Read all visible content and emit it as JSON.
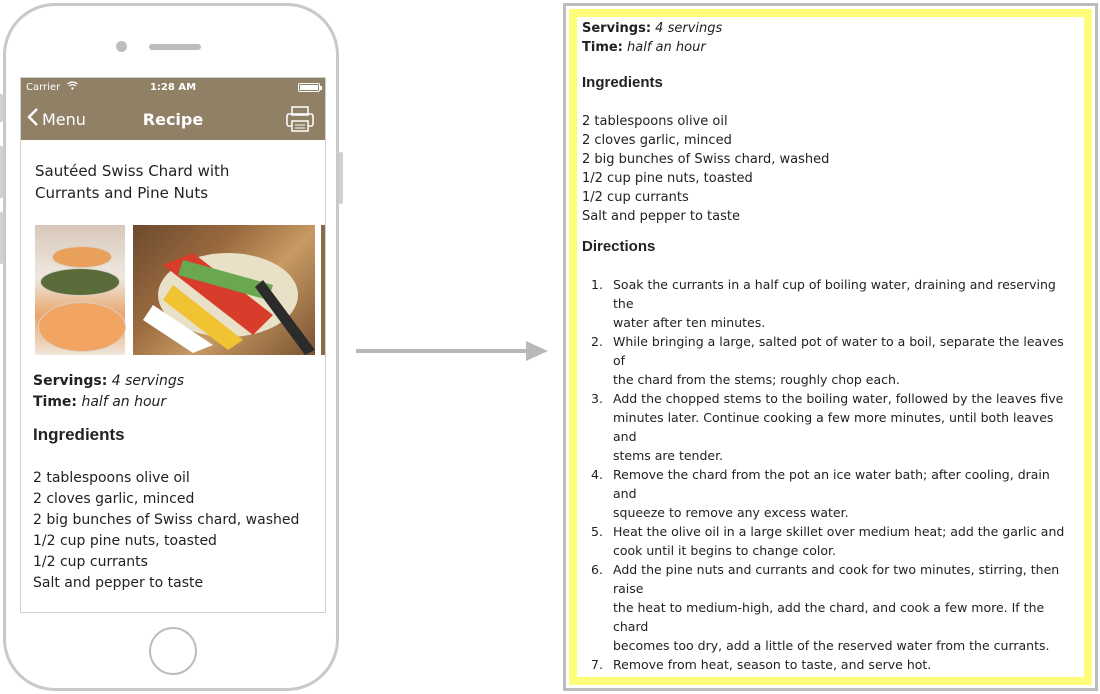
{
  "phone": {
    "status": {
      "carrier": "Carrier",
      "time": "1:28 AM"
    },
    "nav": {
      "back_label": "Menu",
      "title": "Recipe"
    },
    "recipe_title": "Sautéed Swiss Chard with Currants and Pine Nuts",
    "servings_label": "Servings:",
    "servings_value": "4 servings",
    "time_label": "Time:",
    "time_value": "half an hour",
    "ingredients_heading": "Ingredients",
    "ingredients": [
      "2 tablespoons olive oil",
      "2 cloves garlic, minced",
      "2 big bunches of Swiss chard, washed",
      "1/2 cup pine nuts, toasted",
      "1/2 cup currants",
      "Salt and pepper to taste"
    ]
  },
  "print": {
    "servings_label": "Servings:",
    "servings_value": "4 servings",
    "time_label": "Time:",
    "time_value": "half an hour",
    "ingredients_heading": "Ingredients",
    "ingredients": [
      "2 tablespoons olive oil",
      "2 cloves garlic, minced",
      "2 big bunches of Swiss chard, washed",
      "1/2 cup pine nuts, toasted",
      "1/2 cup currants",
      "Salt and pepper to taste"
    ],
    "directions_heading": "Directions",
    "directions": [
      {
        "num": "1.",
        "lines": [
          "Soak the currants in a half cup of boiling water, draining and reserving the",
          "water after ten minutes."
        ]
      },
      {
        "num": "2.",
        "lines": [
          "While bringing a large, salted pot of water to a boil, separate the leaves of",
          "the chard from the stems; roughly chop each."
        ]
      },
      {
        "num": "3.",
        "lines": [
          "Add the chopped stems to the boiling water, followed by the leaves five",
          "minutes later. Continue cooking a few more minutes, until both leaves and",
          "stems are tender."
        ]
      },
      {
        "num": "4.",
        "lines": [
          "Remove the chard from the pot an ice water bath; after cooling, drain and",
          "squeeze to remove any excess water."
        ]
      },
      {
        "num": "5.",
        "lines": [
          "Heat the olive oil in a large skillet over medium heat; add the garlic and",
          "cook until it begins to change color."
        ]
      },
      {
        "num": "6.",
        "lines": [
          "Add the pine nuts and currants and cook for two minutes, stirring, then raise",
          "the heat to medium-high, add the chard, and cook a few more. If the chard",
          "becomes too dry, add a little of the reserved water from the currants."
        ]
      },
      {
        "num": "7.",
        "lines": [
          "Remove from heat, season to taste, and serve hot."
        ]
      }
    ]
  },
  "icons": {
    "wifi": "wifi-icon",
    "battery": "battery-icon",
    "back": "chevron-left-icon",
    "print": "printer-icon",
    "arrow": "arrow-right-icon"
  },
  "colors": {
    "nav_bar": "#8f8066",
    "page_highlight": "#fdfd7a",
    "device_frame": "#c9c9c9"
  }
}
